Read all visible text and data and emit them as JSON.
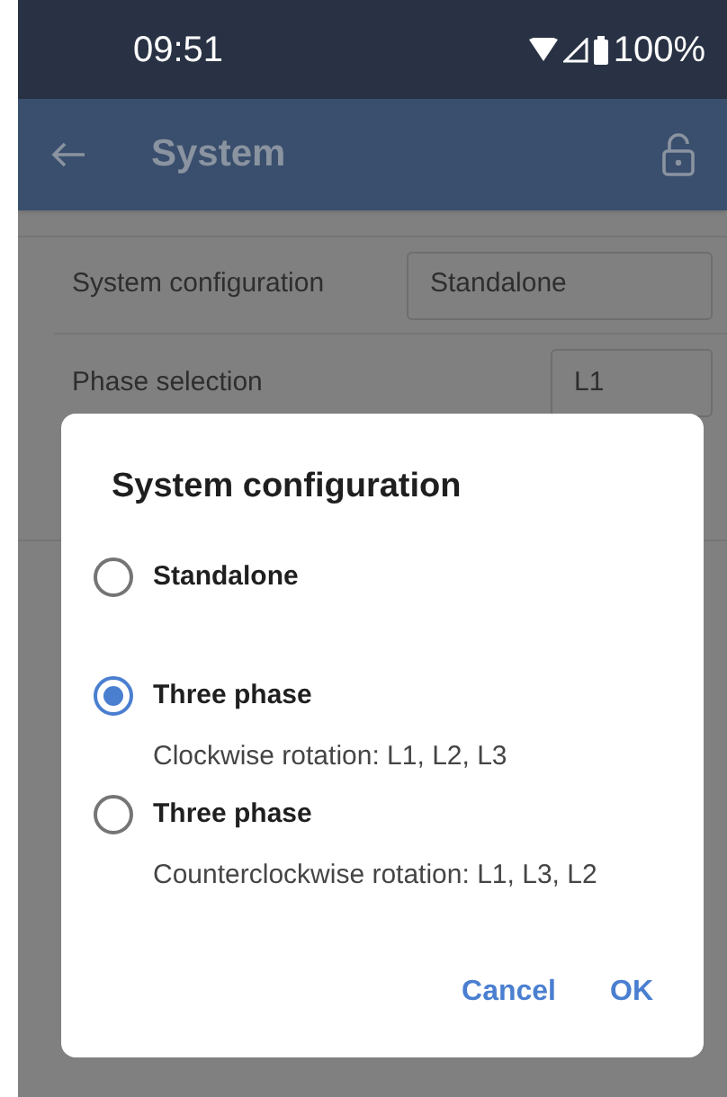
{
  "status_bar": {
    "time": "09:51",
    "battery": "100%"
  },
  "app_bar": {
    "title": "System"
  },
  "settings": [
    {
      "label": "System configuration",
      "value": "Standalone",
      "kind": "wide"
    },
    {
      "label": "Phase selection",
      "value": "L1",
      "kind": "narrow"
    }
  ],
  "dialog": {
    "title": "System configuration",
    "options": [
      {
        "label": "Standalone",
        "selected": false
      },
      {
        "label": "Three phase",
        "description": "Clockwise rotation: L1, L2, L3",
        "selected": true
      },
      {
        "label": "Three phase",
        "description": "Counterclockwise rotation: L1, L3, L2",
        "selected": false
      }
    ],
    "buttons": [
      "Cancel",
      "OK"
    ]
  }
}
